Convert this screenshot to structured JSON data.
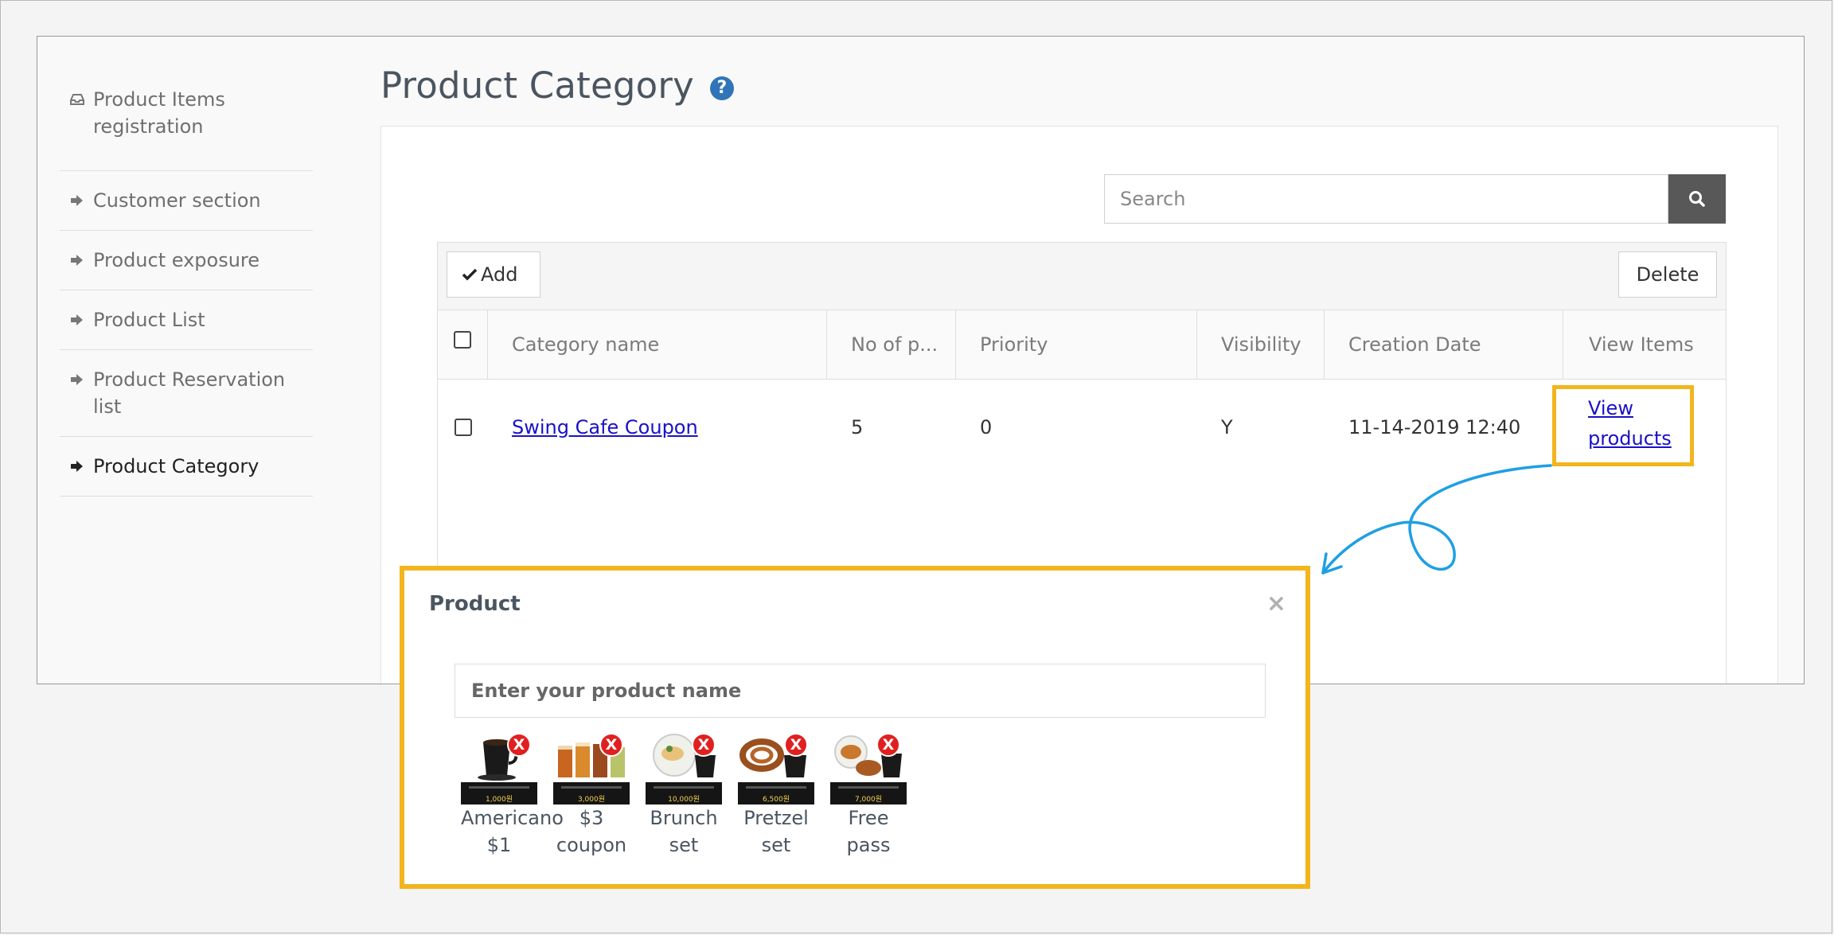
{
  "sidebar": {
    "items": [
      {
        "label": "Product Items registration",
        "icon": "inbox-icon"
      },
      {
        "label": "Customer section",
        "icon": "sign-in-icon"
      },
      {
        "label": "Product exposure",
        "icon": "sign-in-icon"
      },
      {
        "label": "Product List",
        "icon": "sign-in-icon"
      },
      {
        "label": "Product Reservation list",
        "icon": "sign-in-icon"
      },
      {
        "label": "Product Category",
        "icon": "sign-in-icon",
        "active": true
      }
    ]
  },
  "page": {
    "title": "Product Category",
    "help_symbol": "?"
  },
  "search": {
    "placeholder": "Search",
    "button_icon": "search-icon"
  },
  "toolbar": {
    "add_label": "Add",
    "delete_label": "Delete"
  },
  "table": {
    "headers": [
      "Category name",
      "No of p...",
      "Priority",
      "Visibility",
      "Creation Date",
      "View Items"
    ],
    "rows": [
      {
        "category_name": "Swing Cafe Coupon",
        "count": "5",
        "priority": "0",
        "visibility": "Y",
        "creation_date": "11-14-2019 12:40",
        "view_items": "View products"
      }
    ]
  },
  "modal": {
    "title": "Product",
    "close_symbol": "×",
    "input_placeholder": "Enter your product name",
    "remove_symbol": "X",
    "products": [
      {
        "label": "Americano $1",
        "price": "1,000원"
      },
      {
        "label": "$3 coupon",
        "price": "3,000원"
      },
      {
        "label": "Brunch set",
        "price": "10,000원"
      },
      {
        "label": "Pretzel set",
        "price": "6,500원"
      },
      {
        "label": "Free pass",
        "price": "7,000원"
      }
    ]
  },
  "colors": {
    "highlight": "#f2b51e",
    "arrow": "#1f9fe3",
    "link": "#1a10c9",
    "help": "#3174b8"
  }
}
